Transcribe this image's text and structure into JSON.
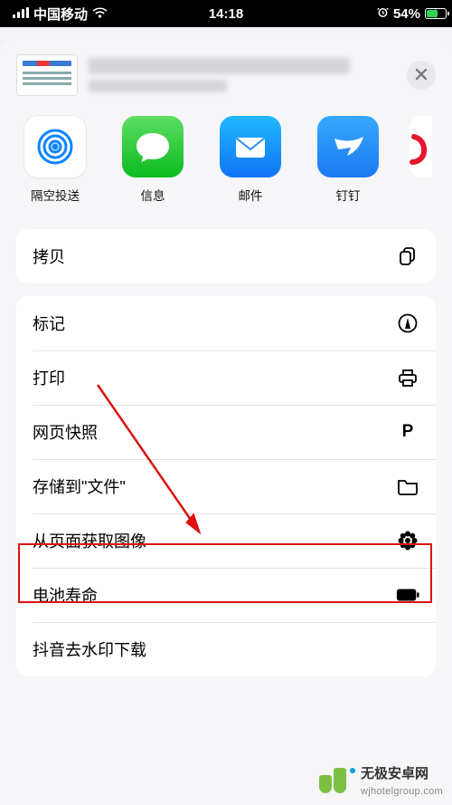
{
  "status": {
    "carrier": "中国移动",
    "time": "14:18",
    "battery_pct": "54%"
  },
  "share_targets": [
    {
      "key": "airdrop",
      "label": "隔空投送"
    },
    {
      "key": "messages",
      "label": "信息"
    },
    {
      "key": "mail",
      "label": "邮件"
    },
    {
      "key": "dingtalk",
      "label": "钉钉"
    }
  ],
  "actions_group1": [
    {
      "key": "copy",
      "label": "拷贝",
      "icon": "copy-icon"
    }
  ],
  "actions_group2": [
    {
      "key": "markup",
      "label": "标记",
      "icon": "markup-icon"
    },
    {
      "key": "print",
      "label": "打印",
      "icon": "print-icon"
    },
    {
      "key": "webarchive",
      "label": "网页快照",
      "icon": "p-icon"
    },
    {
      "key": "save-to-files",
      "label": "存储到\"文件\"",
      "icon": "folder-icon"
    },
    {
      "key": "get-images",
      "label": "从页面获取图像",
      "icon": "flower-icon"
    },
    {
      "key": "battery-life",
      "label": "电池寿命",
      "icon": "battery-icon"
    },
    {
      "key": "douyin-dl",
      "label": "抖音去水印下载",
      "icon": ""
    }
  ],
  "highlighted_action": "save-to-files",
  "watermark": {
    "title": "无极安卓网",
    "sub": "wjhotelgroup.com"
  }
}
